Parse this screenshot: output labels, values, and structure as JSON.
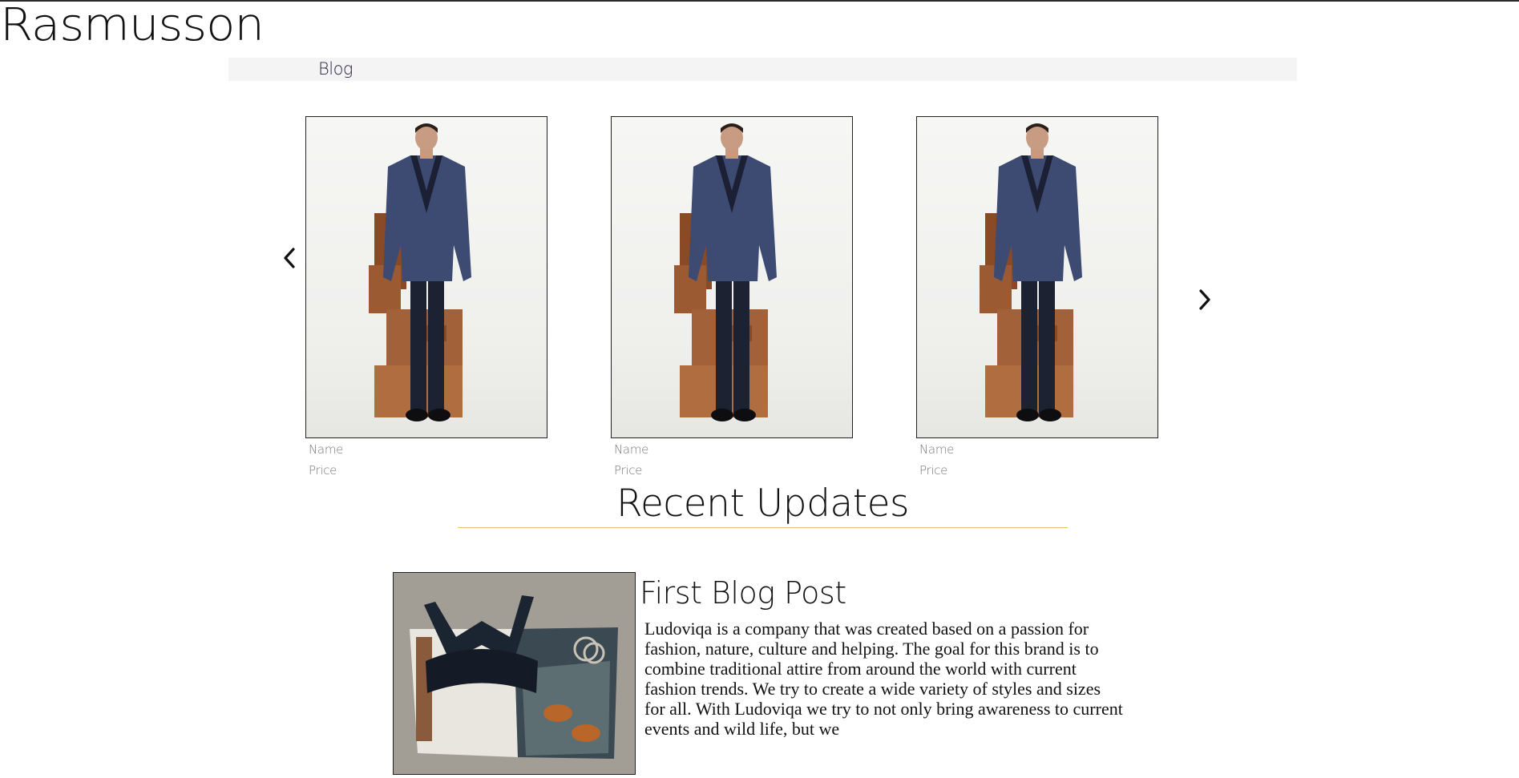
{
  "header": {
    "brand": "Rasmusson",
    "nav": [
      {
        "label": "Blog"
      }
    ]
  },
  "carousel": {
    "prev_icon": "chevron-left-icon",
    "next_icon": "chevron-right-icon",
    "products": [
      {
        "name": "Name",
        "price": "Price",
        "image": "model-in-navy-quilted-jacket"
      },
      {
        "name": "Name",
        "price": "Price",
        "image": "model-in-navy-quilted-jacket"
      },
      {
        "name": "Name",
        "price": "Price",
        "image": "model-in-navy-quilted-jacket"
      }
    ]
  },
  "updates": {
    "title": "Recent Updates",
    "accent_color": "#e5c16a",
    "post": {
      "title": "First Blog Post",
      "image": "lace-bralette-flatlay-on-magazine",
      "body": "Ludoviqa is a company that was created based on a passion for fashion, nature, culture and helping. The goal for this brand is to combine traditional attire from around the world with current fashion trends. We try to create a wide variety of styles and sizes for all. With Ludoviqa we try to not only bring awareness to current events and wild life, but we"
    }
  }
}
